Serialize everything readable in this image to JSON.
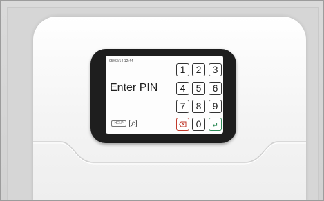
{
  "screen": {
    "datetime": "05/03/14 12:44",
    "prompt": "Enter PIN",
    "help_label": "HELP"
  },
  "keypad": {
    "keys": [
      "1",
      "2",
      "3",
      "4",
      "5",
      "6",
      "7",
      "8",
      "9",
      "0"
    ]
  },
  "icons": {
    "delete": "backspace-icon",
    "enter": "enter-return-icon",
    "search": "magnifier-icon"
  },
  "colors": {
    "delete_key": "#c0392b",
    "enter_key": "#2e8b57",
    "bezel": "#1e1e1e"
  }
}
